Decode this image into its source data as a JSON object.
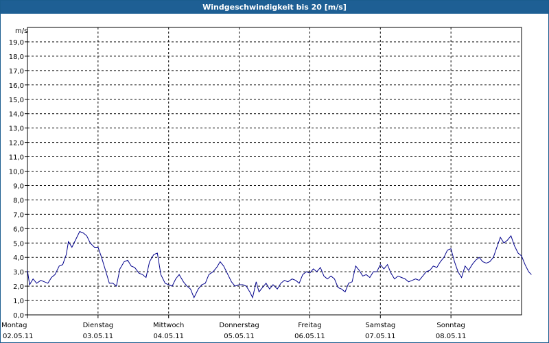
{
  "window": {
    "title": "Windgeschwindigkeit bis 20 [m/s]"
  },
  "colors": {
    "titlebar": "#1e5f94",
    "series": "#00008b",
    "grid": "#000000"
  },
  "chart_data": {
    "type": "line",
    "title": "Windgeschwindigkeit bis 20 [m/s]",
    "ylabel": "m/s",
    "ylim": [
      0,
      20
    ],
    "ytick_step": 1,
    "yticks": [
      "0,0",
      "1,0",
      "2,0",
      "3,0",
      "4,0",
      "5,0",
      "6,0",
      "7,0",
      "8,0",
      "9,0",
      "10,0",
      "11,0",
      "12,0",
      "13,0",
      "14,0",
      "15,0",
      "16,0",
      "17,0",
      "18,0",
      "19,0"
    ],
    "xlim": [
      0,
      7
    ],
    "days": [
      {
        "day": "Montag",
        "date": "02.05.11"
      },
      {
        "day": "Dienstag",
        "date": "03.05.11"
      },
      {
        "day": "Mittwoch",
        "date": "04.05.11"
      },
      {
        "day": "Donnerstag",
        "date": "05.05.11"
      },
      {
        "day": "Freitag",
        "date": "06.05.11"
      },
      {
        "day": "Samstag",
        "date": "07.05.11"
      },
      {
        "day": "Sonntag",
        "date": "08.05.11"
      }
    ],
    "grid": true,
    "series": [
      {
        "points": [
          [
            0.0,
            3.1
          ],
          [
            0.03,
            2.1
          ],
          [
            0.08,
            2.5
          ],
          [
            0.13,
            2.2
          ],
          [
            0.19,
            2.4
          ],
          [
            0.24,
            2.3
          ],
          [
            0.29,
            2.2
          ],
          [
            0.34,
            2.6
          ],
          [
            0.39,
            2.8
          ],
          [
            0.45,
            3.4
          ],
          [
            0.5,
            3.5
          ],
          [
            0.55,
            4.2
          ],
          [
            0.58,
            5.1
          ],
          [
            0.63,
            4.7
          ],
          [
            0.68,
            5.2
          ],
          [
            0.74,
            5.8
          ],
          [
            0.79,
            5.7
          ],
          [
            0.84,
            5.5
          ],
          [
            0.89,
            5.0
          ],
          [
            0.95,
            4.7
          ],
          [
            1.0,
            4.7
          ],
          [
            1.05,
            4.0
          ],
          [
            1.1,
            3.2
          ],
          [
            1.16,
            2.2
          ],
          [
            1.21,
            2.2
          ],
          [
            1.26,
            2.0
          ],
          [
            1.31,
            3.2
          ],
          [
            1.37,
            3.7
          ],
          [
            1.42,
            3.8
          ],
          [
            1.47,
            3.4
          ],
          [
            1.52,
            3.3
          ],
          [
            1.58,
            2.9
          ],
          [
            1.63,
            2.8
          ],
          [
            1.68,
            2.6
          ],
          [
            1.73,
            3.7
          ],
          [
            1.79,
            4.2
          ],
          [
            1.84,
            4.3
          ],
          [
            1.89,
            2.8
          ],
          [
            1.95,
            2.2
          ],
          [
            2.0,
            2.1
          ],
          [
            2.05,
            2.0
          ],
          [
            2.1,
            2.5
          ],
          [
            2.15,
            2.8
          ],
          [
            2.21,
            2.3
          ],
          [
            2.26,
            2.0
          ],
          [
            2.31,
            1.8
          ],
          [
            2.36,
            1.2
          ],
          [
            2.42,
            1.8
          ],
          [
            2.47,
            2.1
          ],
          [
            2.52,
            2.2
          ],
          [
            2.57,
            2.8
          ],
          [
            2.63,
            3.0
          ],
          [
            2.68,
            3.3
          ],
          [
            2.73,
            3.7
          ],
          [
            2.78,
            3.4
          ],
          [
            2.84,
            2.8
          ],
          [
            2.89,
            2.3
          ],
          [
            2.94,
            2.0
          ],
          [
            3.0,
            2.1
          ],
          [
            3.05,
            2.1
          ],
          [
            3.1,
            2.0
          ],
          [
            3.15,
            1.6
          ],
          [
            3.19,
            1.2
          ],
          [
            3.24,
            2.3
          ],
          [
            3.28,
            1.6
          ],
          [
            3.33,
            1.9
          ],
          [
            3.38,
            2.2
          ],
          [
            3.43,
            1.8
          ],
          [
            3.48,
            2.1
          ],
          [
            3.54,
            1.8
          ],
          [
            3.59,
            2.2
          ],
          [
            3.64,
            2.4
          ],
          [
            3.69,
            2.3
          ],
          [
            3.75,
            2.5
          ],
          [
            3.8,
            2.4
          ],
          [
            3.85,
            2.2
          ],
          [
            3.9,
            2.8
          ],
          [
            3.95,
            3.0
          ],
          [
            4.0,
            2.9
          ],
          [
            4.05,
            3.2
          ],
          [
            4.1,
            3.0
          ],
          [
            4.15,
            3.3
          ],
          [
            4.2,
            2.7
          ],
          [
            4.25,
            2.5
          ],
          [
            4.3,
            2.7
          ],
          [
            4.35,
            2.5
          ],
          [
            4.4,
            1.9
          ],
          [
            4.45,
            1.8
          ],
          [
            4.5,
            1.6
          ],
          [
            4.55,
            2.2
          ],
          [
            4.6,
            2.3
          ],
          [
            4.65,
            3.4
          ],
          [
            4.7,
            3.1
          ],
          [
            4.75,
            2.7
          ],
          [
            4.8,
            2.8
          ],
          [
            4.85,
            2.6
          ],
          [
            4.9,
            3.0
          ],
          [
            4.95,
            3.0
          ],
          [
            5.0,
            3.5
          ],
          [
            5.05,
            3.2
          ],
          [
            5.1,
            3.5
          ],
          [
            5.15,
            2.9
          ],
          [
            5.2,
            2.5
          ],
          [
            5.25,
            2.7
          ],
          [
            5.3,
            2.6
          ],
          [
            5.35,
            2.5
          ],
          [
            5.4,
            2.3
          ],
          [
            5.45,
            2.4
          ],
          [
            5.5,
            2.5
          ],
          [
            5.55,
            2.4
          ],
          [
            5.6,
            2.7
          ],
          [
            5.65,
            3.0
          ],
          [
            5.7,
            3.1
          ],
          [
            5.75,
            3.4
          ],
          [
            5.8,
            3.3
          ],
          [
            5.85,
            3.7
          ],
          [
            5.9,
            4.0
          ],
          [
            5.95,
            4.5
          ],
          [
            6.0,
            4.6
          ],
          [
            6.05,
            3.7
          ],
          [
            6.1,
            3.0
          ],
          [
            6.15,
            2.6
          ],
          [
            6.2,
            3.4
          ],
          [
            6.25,
            3.1
          ],
          [
            6.3,
            3.5
          ],
          [
            6.35,
            3.8
          ],
          [
            6.4,
            4.0
          ],
          [
            6.45,
            3.7
          ],
          [
            6.5,
            3.6
          ],
          [
            6.55,
            3.7
          ],
          [
            6.6,
            4.0
          ],
          [
            6.65,
            4.7
          ],
          [
            6.7,
            5.4
          ],
          [
            6.75,
            5.0
          ],
          [
            6.8,
            5.2
          ],
          [
            6.85,
            5.5
          ],
          [
            6.9,
            4.8
          ],
          [
            6.95,
            4.3
          ],
          [
            7.0,
            4.1
          ],
          [
            7.05,
            3.5
          ],
          [
            7.1,
            3.0
          ],
          [
            7.14,
            2.8
          ]
        ]
      }
    ]
  }
}
